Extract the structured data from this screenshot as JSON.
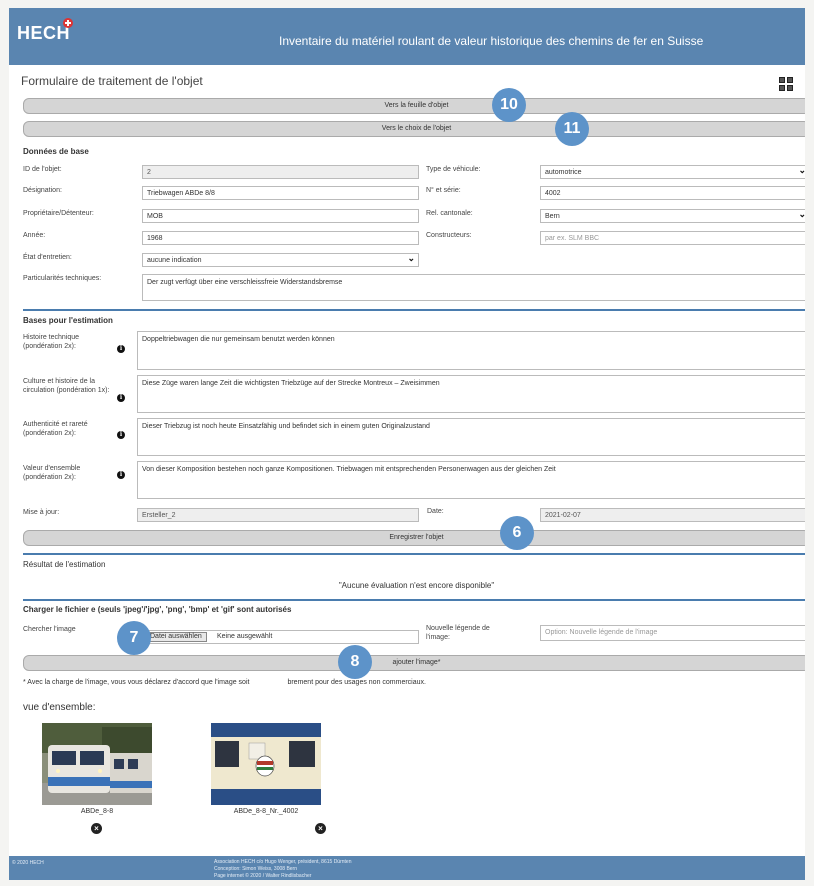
{
  "header": {
    "logo": "HECH",
    "title": "Inventaire du matériel roulant de valeur historique des chemins de fer en Suisse"
  },
  "form": {
    "title": "Formulaire de traitement de l'objet",
    "to_object_sheet": "Vers la feuille d'objet",
    "to_object_choice": "Vers le choix de l'objet"
  },
  "badges": {
    "b10": "10",
    "b11": "11",
    "b6": "6",
    "b7": "7",
    "b8": "8"
  },
  "basics": {
    "title": "Données de base",
    "id_label": "ID de l'objet:",
    "id_value": "2",
    "designation_label": "Désignation:",
    "designation_value": "Triebwagen ABDe 8/8",
    "owner_label": "Propriétaire/Détenteur:",
    "owner_value": "MOB",
    "year_label": "Année:",
    "year_value": "1968",
    "state_label": "État d'entretien:",
    "state_value": "aucune indication",
    "tech_label": "Particularités techniques:",
    "tech_value": "Der zugt verfügt über eine verschleissfreie Widerstandsbremse",
    "vehicle_type_label": "Type de véhicule:",
    "vehicle_type_value": "automotrice",
    "serial_label": "N° et série:",
    "serial_value": "4002",
    "canton_label": "Rel. cantonale:",
    "canton_value": "Bern",
    "builders_label": "Constructeurs:",
    "builders_placeholder": "par ex. SLM BBC"
  },
  "estimation": {
    "title": "Bases pour l'estimation",
    "history_label": "Histoire technique (pondération 2x):",
    "history_value": "Doppeltriebwagen die nur gemeinsam benutzt werden können",
    "culture_label": "Culture et histoire de la circulation (pondération 1x):",
    "culture_value": "Diese Züge waren lange Zeit die wichtigsten Triebzüge auf der Strecke Montreux – Zweisimmen",
    "authenticity_label": "Authenticité et rareté (pondération 2x):",
    "authenticity_value": "Dieser Triebzug ist noch heute Einsatzfähig und befindet sich in einem guten Originalzustand",
    "ensemble_label": "Valeur d'ensemble (pondération 2x):",
    "ensemble_value": "Von dieser Komposition bestehen noch ganze Kompositionen. Triebwagen mit entsprechenden Personenwagen aus der gleichen Zeit",
    "update_label": "Mise à jour:",
    "update_value": "Ersteller_2",
    "date_label": "Date:",
    "date_value": "2021-02-07",
    "save_button": "Enregistrer l'objet"
  },
  "result": {
    "title": "Résultat de l'estimation",
    "text": "\"Aucune évaluation n'est encore disponible\""
  },
  "upload": {
    "title": "Charger le fichier (seuls 'jpeg'/'jpg', 'png', 'bmp' et 'gif' sont autorisés",
    "title_a": "Charger le fichier",
    "title_b": "e (seuls 'jpeg'/'jpg', 'png', 'bmp' et 'gif' sont autorisés",
    "search_label": "Chercher l'image",
    "choose_button": "Datei auswählen",
    "no_file": "Keine ausgewählt",
    "caption_label": "Nouvelle légende de l'image:",
    "caption_placeholder": "Option: Nouvelle légende de l'image",
    "add_button": "ajouter l'image*",
    "notice": "* Avec la charge de l'image, vous vous déclarez d'accord que l'image soit",
    "notice_tail": "brement pour des usages non commerciaux."
  },
  "overview": {
    "title": "vue d'ensemble:",
    "images": [
      {
        "caption": "ABDe_8-8"
      },
      {
        "caption": "ABDe_8-8_Nr._4002"
      }
    ]
  },
  "footer": {
    "left": "© 2020 HECH",
    "line1": "Association HECH c/o Hugo Wenger, président, 8615 Dürnten",
    "line2": "Conception: Simon Weiss, 3008 Bern",
    "line3": "Page internet © 2020 / Walter Rindlisbacher"
  },
  "colors": {
    "header": "#5a85b0",
    "badge": "#5d93c9",
    "section_line": "#4a7cae"
  }
}
